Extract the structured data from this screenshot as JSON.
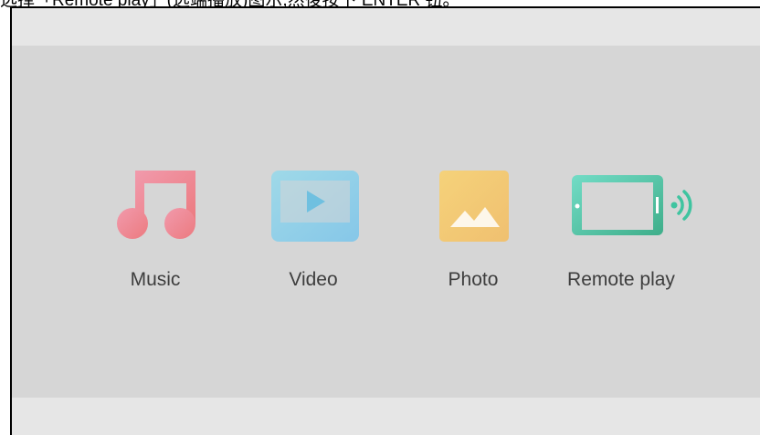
{
  "caption": "选择「Remote play」(远端播放)图示,然後按下 ENTER 钮。",
  "tiles": [
    {
      "label": "Music",
      "icon": "music-note-icon",
      "color": "#ef7f93"
    },
    {
      "label": "Video",
      "icon": "video-play-icon",
      "color": "#8fd0e6"
    },
    {
      "label": "Photo",
      "icon": "photo-landscape-icon",
      "color": "#f2c46e"
    },
    {
      "label": "Remote play",
      "icon": "remote-play-tablet-icon",
      "color": "#3fbf99"
    }
  ]
}
